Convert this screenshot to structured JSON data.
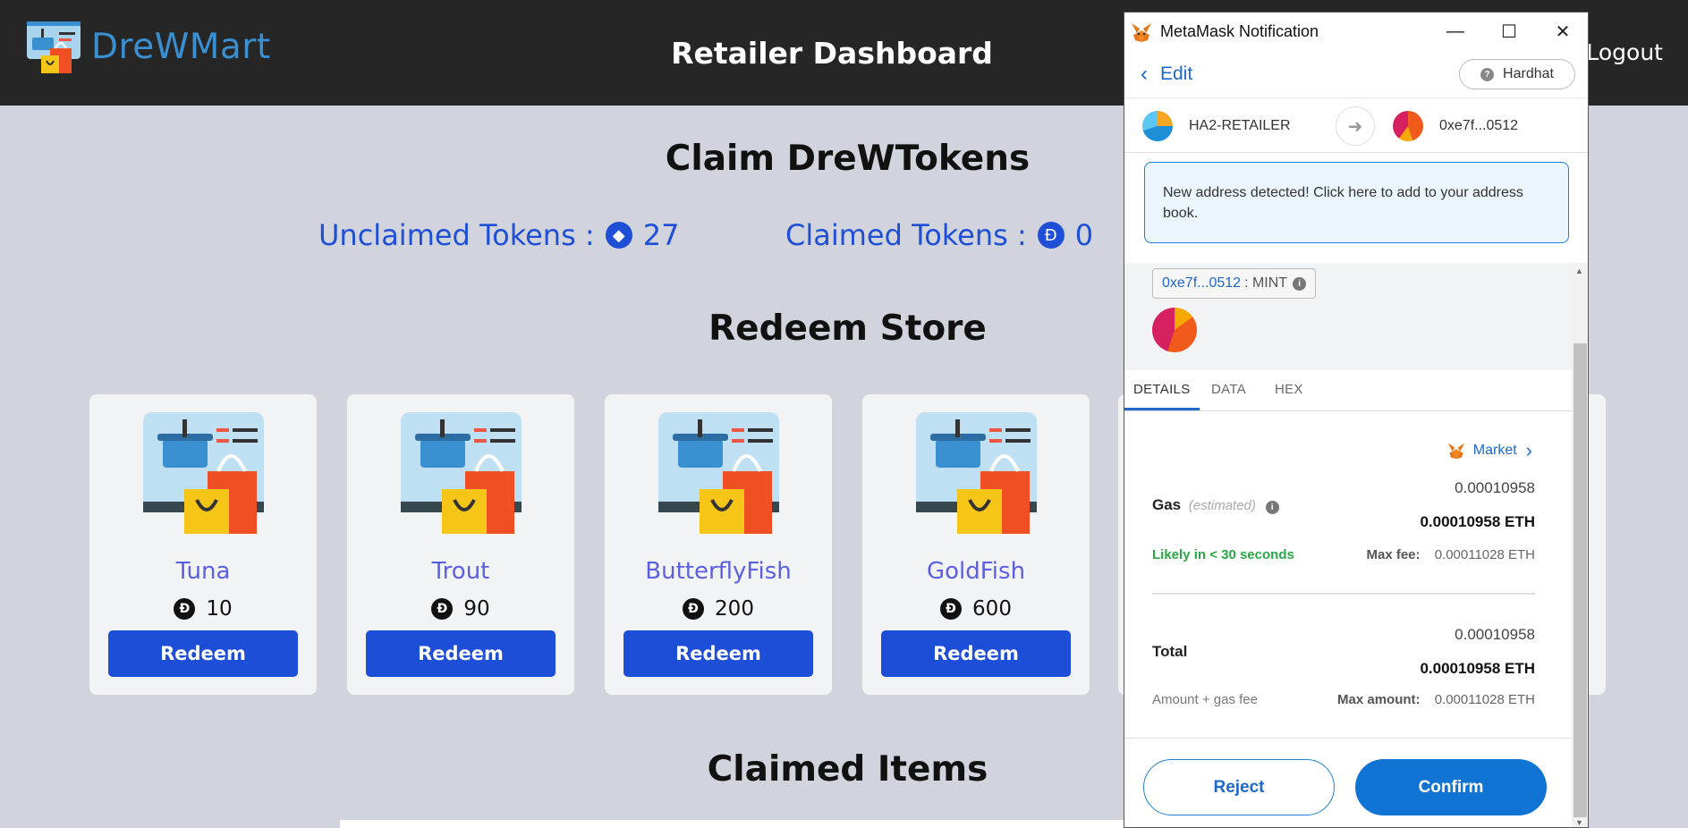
{
  "app": {
    "logo_text": "DreWMart",
    "nav_title": "Retailer Dashboard",
    "logout": "Logout"
  },
  "claim": {
    "heading": "Claim DreWTokens",
    "unclaimed_label": "Unclaimed Tokens :",
    "unclaimed_value": "27",
    "claimed_label": "Claimed Tokens :",
    "claimed_value": "0"
  },
  "store": {
    "heading": "Redeem Store",
    "currency_symbol": "Đ",
    "items": [
      {
        "name": "Tuna",
        "price": "10",
        "button": "Redeem"
      },
      {
        "name": "Trout",
        "price": "90",
        "button": "Redeem"
      },
      {
        "name": "ButterflyFish",
        "price": "200",
        "button": "Redeem"
      },
      {
        "name": "GoldFish",
        "price": "600",
        "button": "Redeem"
      }
    ]
  },
  "claimed_items": {
    "heading": "Claimed Items"
  },
  "metamask": {
    "window_title": "MetaMask Notification",
    "edit": "Edit",
    "network": "Hardhat",
    "from_account": "HA2-RETAILER",
    "to_account": "0xe7f...0512",
    "notice": "New address detected! Click here to add to your address book.",
    "contract_address": "0xe7f...0512",
    "method": ": MINT",
    "tabs": [
      "DETAILS",
      "DATA",
      "HEX"
    ],
    "market": "Market",
    "gas_label": "Gas",
    "gas_estimated": "(estimated)",
    "gas_value": "0.00010958",
    "gas_eth": "0.00010958 ETH",
    "likely": "Likely in < 30 seconds",
    "max_fee_label": "Max fee:",
    "max_fee_value": "0.00011028 ETH",
    "total_label": "Total",
    "total_value": "0.00010958",
    "total_eth": "0.00010958 ETH",
    "amount_gas_label": "Amount + gas fee",
    "max_amount_label": "Max amount:",
    "max_amount_value": "0.00011028 ETH",
    "reject": "Reject",
    "confirm": "Confirm"
  },
  "colors": {
    "brand_blue": "#1d4ed8",
    "token_blue": "#1f4fd6",
    "item_name": "#5b5fe0",
    "metamask_blue": "#1074d4",
    "success_green": "#28a745"
  }
}
